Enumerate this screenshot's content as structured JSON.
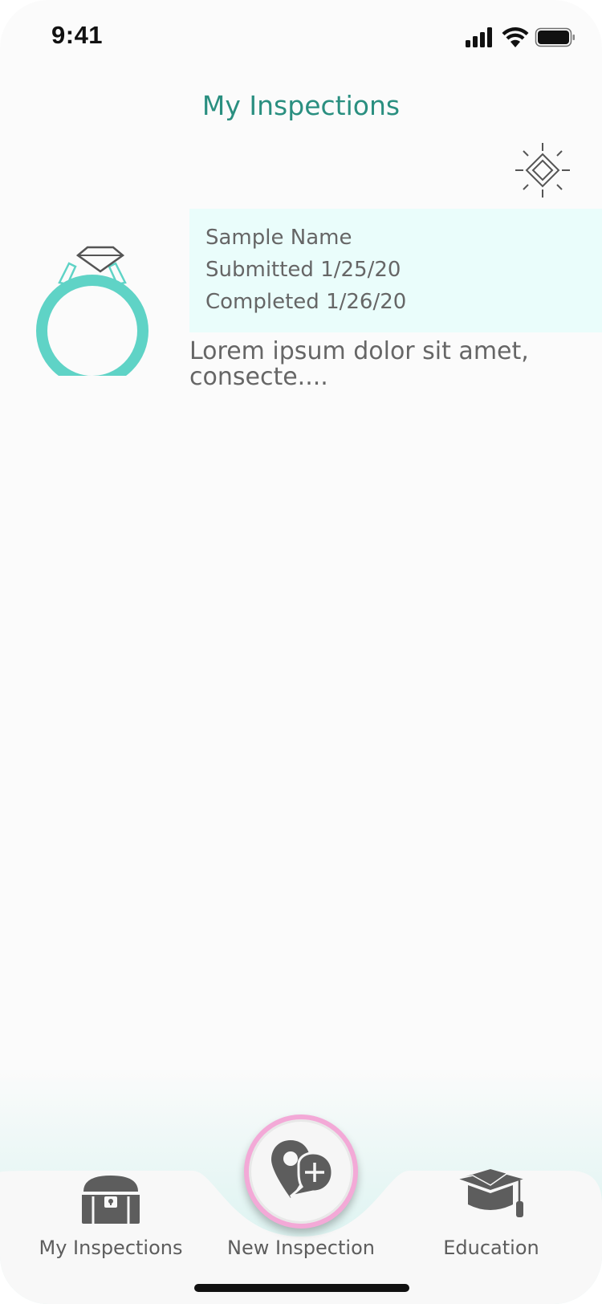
{
  "status_bar": {
    "time": "9:41"
  },
  "header": {
    "title": "My Inspections"
  },
  "inspection": {
    "name": "Sample Name",
    "submitted": "Submitted 1/25/20",
    "completed": "Completed 1/26/20",
    "description": "Lorem ipsum dolor sit amet, consecte...."
  },
  "tabs": [
    {
      "label": "My Inspections",
      "icon": "treasure-chest-icon"
    },
    {
      "label": "New Inspection",
      "icon": "location-pin-plus-icon"
    },
    {
      "label": "Education",
      "icon": "graduation-cap-icon"
    }
  ],
  "colors": {
    "accent": "#5fd3c6",
    "title": "#2a8f80",
    "card_bg": "#eafdfb",
    "fab_ring": "#f3a9d7",
    "icon_gray": "#5d5d5d"
  }
}
